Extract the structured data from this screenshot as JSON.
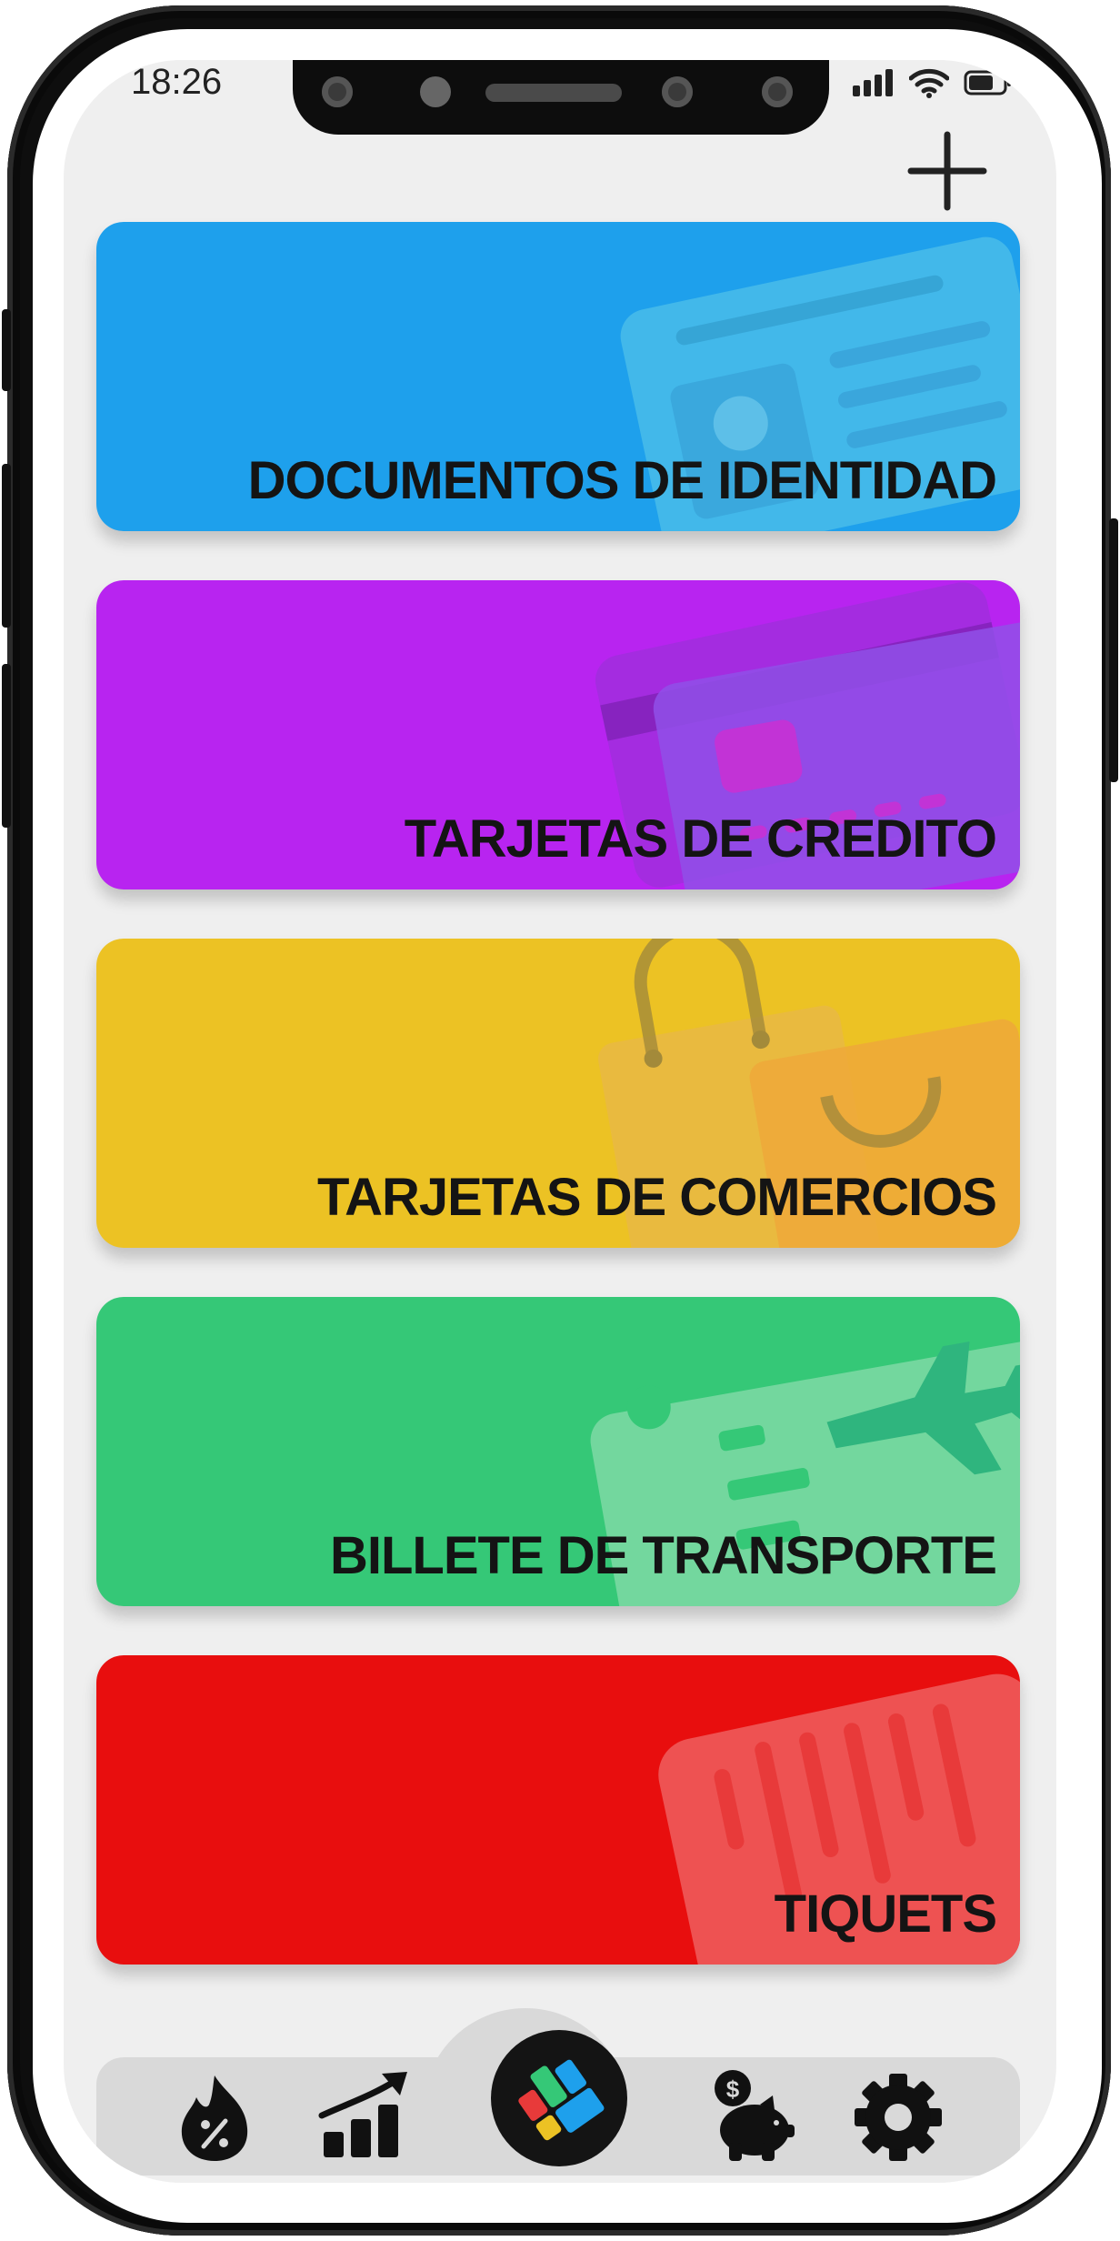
{
  "status_bar": {
    "time": "18:26"
  },
  "header": {
    "add_button_icon": "plus-icon"
  },
  "cards": [
    {
      "label": "DOCUMENTOS DE IDENTIDAD",
      "color": "#1ea0ec",
      "icon": "id-card-icon"
    },
    {
      "label": "TARJETAS DE CREDITO",
      "color": "#b824f0",
      "icon": "credit-card-icon"
    },
    {
      "label": "TARJETAS DE COMERCIOS",
      "color": "#ecc224",
      "icon": "shopping-bag-icon"
    },
    {
      "label": "BILLETE DE TRANSPORTE",
      "color": "#35c877",
      "icon": "plane-ticket-icon"
    },
    {
      "label": "TIQUETS",
      "color": "#e80e0e",
      "icon": "receipt-icon"
    }
  ],
  "bottom_nav": {
    "items": [
      {
        "icon": "discount-fire-icon"
      },
      {
        "icon": "growth-chart-icon"
      },
      {
        "icon": "app-logo-icon"
      },
      {
        "icon": "piggy-bank-icon"
      },
      {
        "icon": "gear-icon"
      }
    ]
  }
}
